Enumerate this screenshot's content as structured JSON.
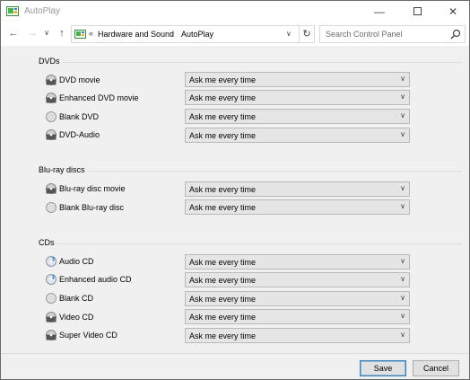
{
  "window": {
    "title": "AutoPlay"
  },
  "address": {
    "breadcrumb": [
      "Hardware and Sound",
      "AutoPlay"
    ],
    "separator": "›"
  },
  "search": {
    "placeholder": "Search Control Panel"
  },
  "sections": [
    {
      "title": "DVDs",
      "rows": [
        {
          "label": "DVD movie",
          "icon": "dvd-drive-icon",
          "value": "Ask me every time"
        },
        {
          "label": "Enhanced DVD movie",
          "icon": "dvd-drive-icon",
          "value": "Ask me every time"
        },
        {
          "label": "Blank DVD",
          "icon": "blank-disc-icon",
          "value": "Ask me every time"
        },
        {
          "label": "DVD-Audio",
          "icon": "dvd-drive-icon",
          "value": "Ask me every time"
        }
      ]
    },
    {
      "title": "Blu-ray discs",
      "rows": [
        {
          "label": "Blu-ray disc movie",
          "icon": "dvd-drive-icon",
          "value": "Ask me every time"
        },
        {
          "label": "Blank Blu-ray disc",
          "icon": "blank-disc-icon",
          "value": "Ask me every time"
        }
      ]
    },
    {
      "title": "CDs",
      "rows": [
        {
          "label": "Audio CD",
          "icon": "audio-cd-icon",
          "value": "Ask me every time"
        },
        {
          "label": "Enhanced audio CD",
          "icon": "audio-cd-icon",
          "value": "Ask me every time"
        },
        {
          "label": "Blank CD",
          "icon": "blank-disc-icon",
          "value": "Ask me every time"
        },
        {
          "label": "Video CD",
          "icon": "dvd-drive-icon",
          "value": "Ask me every time"
        },
        {
          "label": "Super Video CD",
          "icon": "dvd-drive-icon",
          "value": "Ask me every time"
        }
      ]
    }
  ],
  "footer": {
    "save_label": "Save",
    "cancel_label": "Cancel"
  },
  "colors": {
    "accent": "#3c7fb1",
    "background": "#f0f0f0",
    "dropdown": "#e5e5e5"
  }
}
